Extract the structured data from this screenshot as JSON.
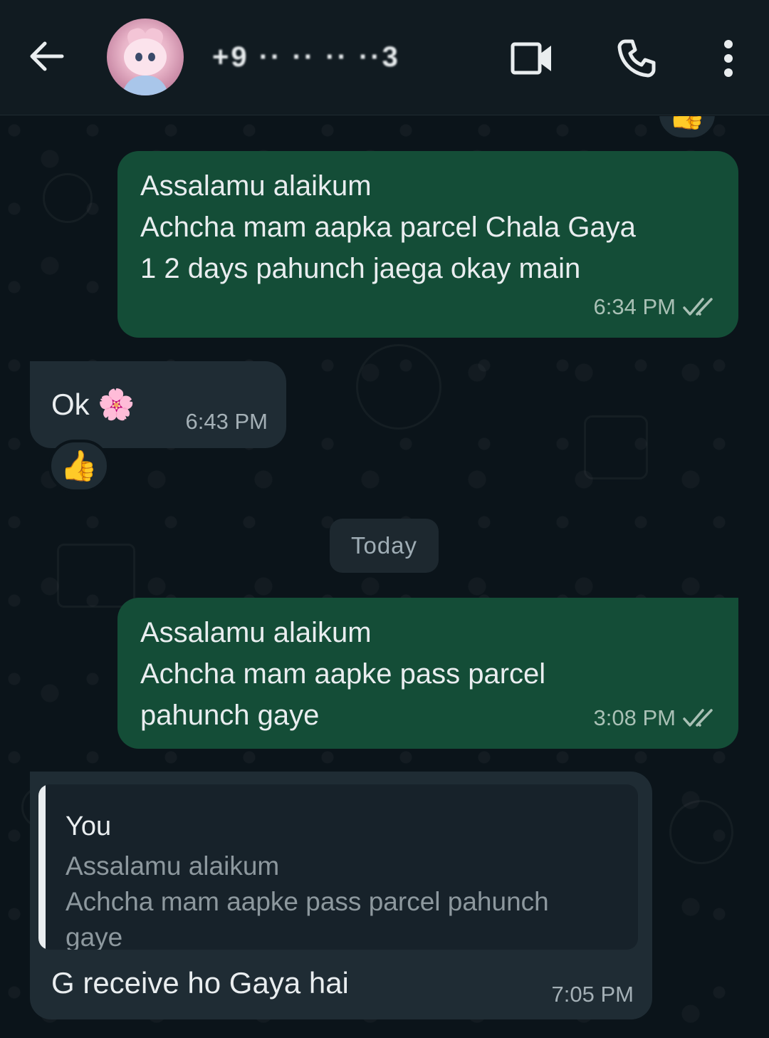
{
  "header": {
    "contact_name": "+9 ·· ·· ·· ··3",
    "icons": {
      "back": "arrow-left-icon",
      "video": "video-call-icon",
      "call": "phone-icon",
      "menu": "more-vertical-icon"
    }
  },
  "colors": {
    "outgoing_bubble": "#144d37",
    "incoming_bubble": "#1f2c34",
    "background": "#0b141a",
    "header": "#111b21"
  },
  "messages": [
    {
      "direction": "out",
      "text": "Assalamu alaikum\nAchcha mam aapka parcel Chala Gaya\n1 2 days pahunch jaega okay main",
      "time": "6:34 PM",
      "status": "read-ticks"
    },
    {
      "direction": "in",
      "text": "Ok 🌸",
      "time": "6:43 PM",
      "reaction": "👍"
    },
    {
      "direction": "out",
      "text": "Assalamu alaikum\nAchcha mam aapke pass parcel\npahunch gaye",
      "time": "3:08 PM",
      "status": "read-ticks"
    },
    {
      "direction": "in",
      "quote_author": "You",
      "quote_text": "Assalamu alaikum\nAchcha mam aapke pass parcel pahunch\ngaye",
      "text": "G receive ho Gaya hai",
      "time": "7:05 PM"
    }
  ],
  "date_divider": "Today",
  "top_reaction": "👍"
}
